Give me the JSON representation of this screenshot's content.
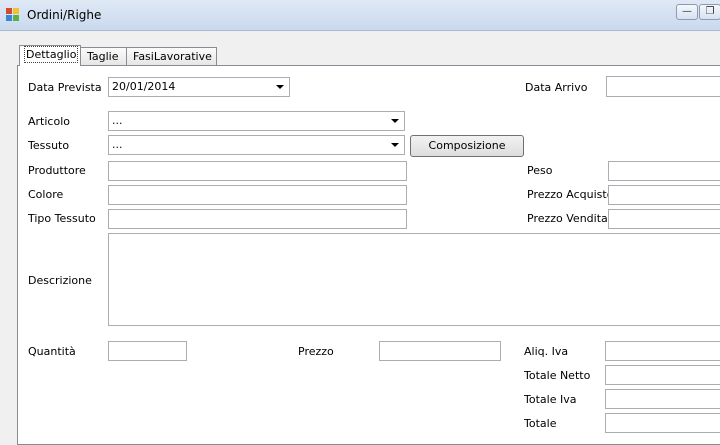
{
  "window": {
    "title": "Ordini/Righe",
    "minimize_glyph": "—",
    "maximize_glyph": "❐",
    "icon": "app-icon"
  },
  "tabs": [
    {
      "label": "Dettaglio",
      "active": true
    },
    {
      "label": "Taglie",
      "active": false
    },
    {
      "label": "FasiLavorative",
      "active": false
    }
  ],
  "form": {
    "data_prevista": {
      "label": "Data Prevista",
      "value": "20/01/2014"
    },
    "data_arrivo": {
      "label": "Data Arrivo",
      "value": ""
    },
    "articolo": {
      "label": "Articolo",
      "value": "..."
    },
    "tessuto": {
      "label": "Tessuto",
      "value": "..."
    },
    "composizione_button": "Composizione",
    "produttore": {
      "label": "Produttore",
      "value": ""
    },
    "peso": {
      "label": "Peso",
      "value": ""
    },
    "colore": {
      "label": "Colore",
      "value": ""
    },
    "prezzo_acquisto": {
      "label": "Prezzo Acquisto",
      "value": ""
    },
    "tipo_tessuto": {
      "label": "Tipo Tessuto",
      "value": ""
    },
    "prezzo_vendita": {
      "label": "Prezzo Vendita",
      "value": ""
    },
    "descrizione": {
      "label": "Descrizione",
      "value": ""
    },
    "quantita": {
      "label": "Quantità",
      "value": ""
    },
    "prezzo": {
      "label": "Prezzo",
      "value": ""
    },
    "aliq_iva": {
      "label": "Aliq. Iva",
      "value": ""
    },
    "totale_netto": {
      "label": "Totale Netto",
      "value": ""
    },
    "totale_iva": {
      "label": "Totale Iva",
      "value": ""
    },
    "totale": {
      "label": "Totale",
      "value": ""
    }
  }
}
